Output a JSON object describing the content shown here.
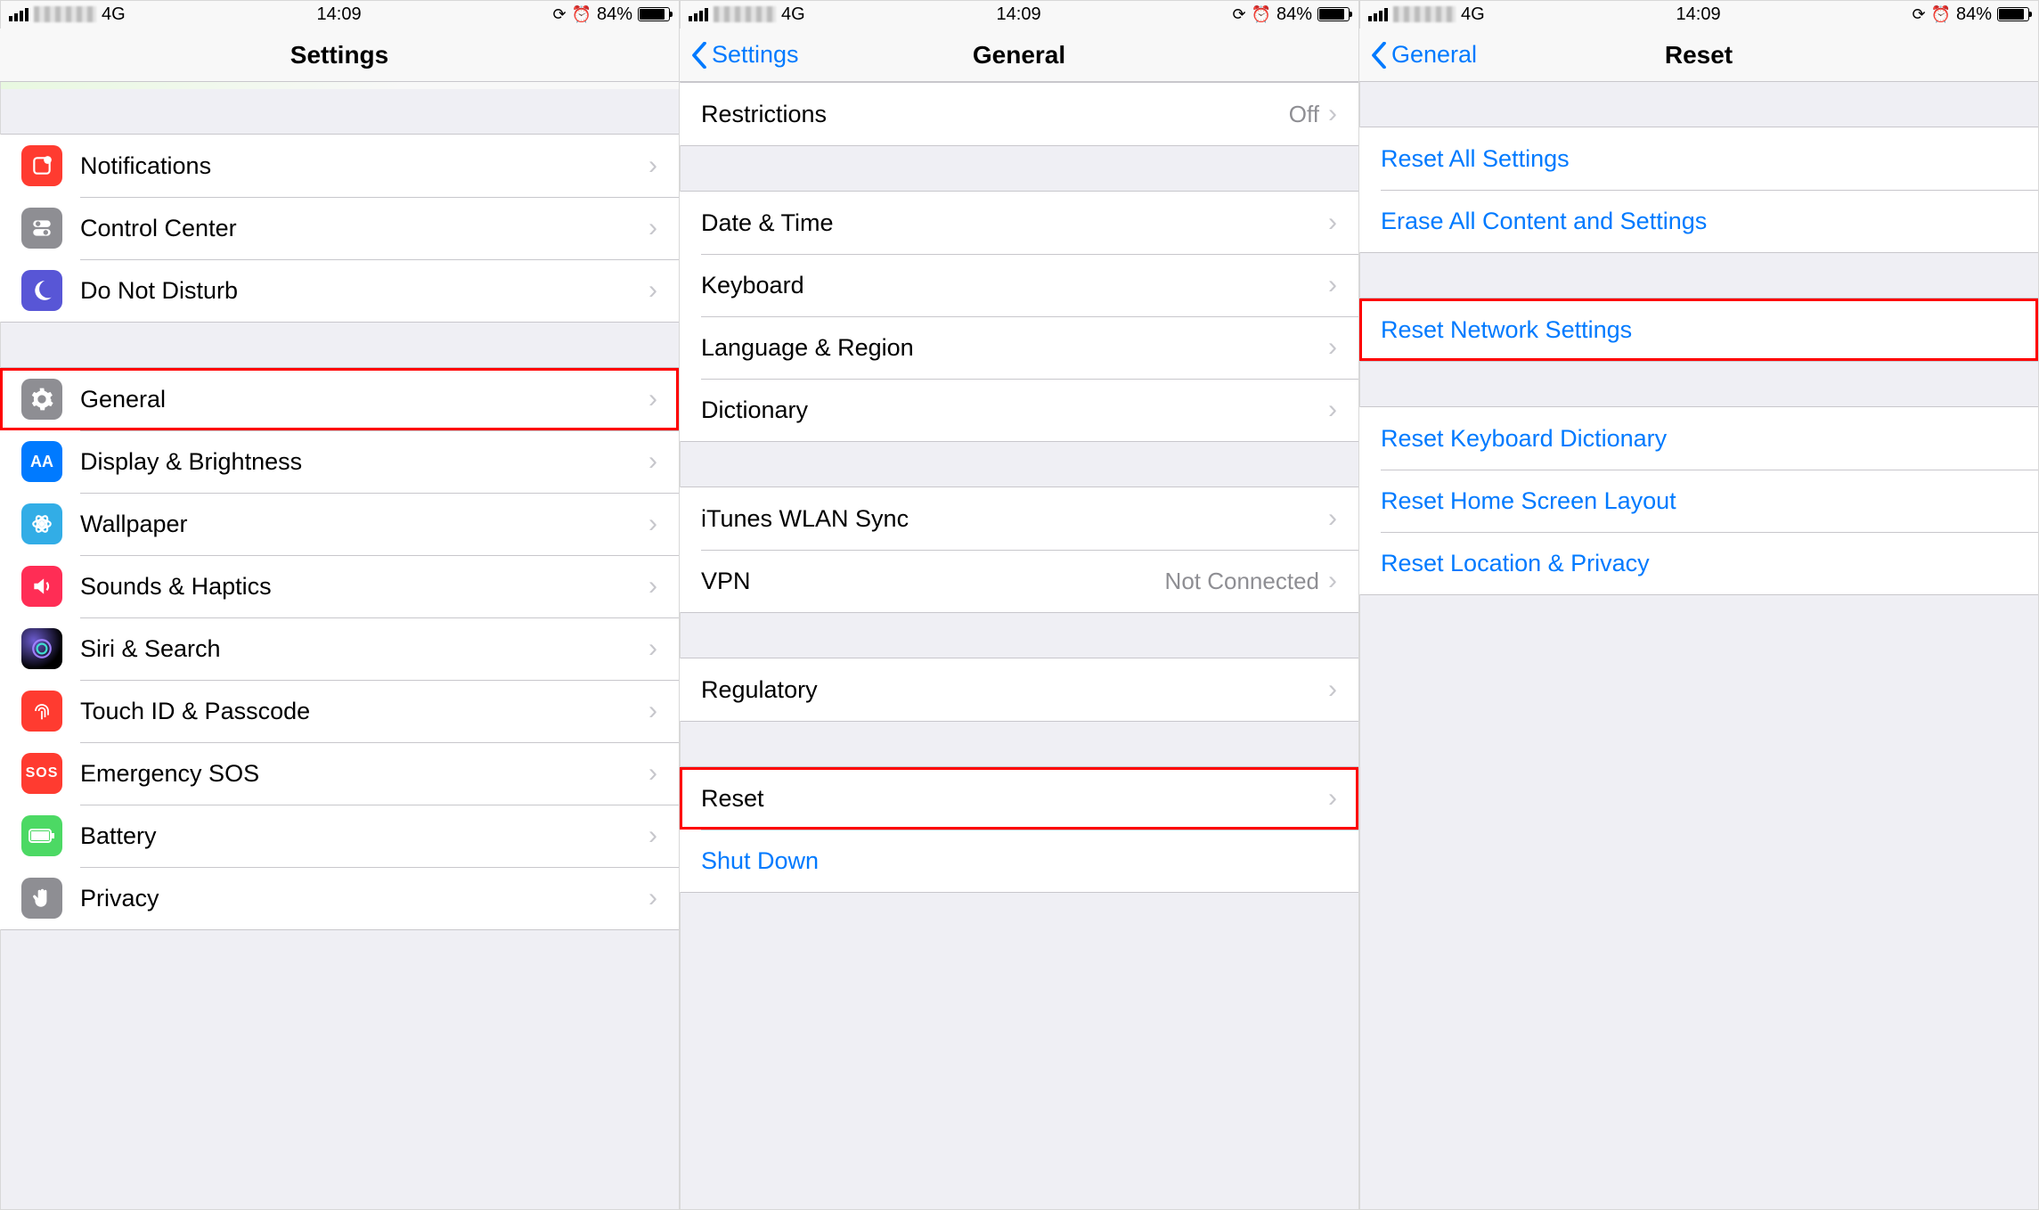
{
  "status": {
    "network": "4G",
    "time": "14:09",
    "battery_pct": "84%"
  },
  "panel1": {
    "title": "Settings",
    "groups": [
      {
        "rows": [
          {
            "icon": "notifications-icon",
            "color": "ic-red",
            "glyph": "☐",
            "label": "Notifications"
          },
          {
            "icon": "control-center-icon",
            "color": "ic-gray",
            "glyph": "⌾",
            "label": "Control Center"
          },
          {
            "icon": "dnd-icon",
            "color": "ic-purple",
            "glyph": "☾",
            "label": "Do Not Disturb"
          }
        ]
      },
      {
        "rows": [
          {
            "icon": "general-icon",
            "color": "ic-gray",
            "glyph": "⚙",
            "label": "General",
            "highlight": true
          },
          {
            "icon": "display-icon",
            "color": "ic-brightness",
            "glyph": "AA",
            "label": "Display & Brightness"
          },
          {
            "icon": "wallpaper-icon",
            "color": "ic-cyan",
            "glyph": "❀",
            "label": "Wallpaper"
          },
          {
            "icon": "sounds-icon",
            "color": "ic-pink",
            "glyph": "🔊",
            "label": "Sounds & Haptics"
          },
          {
            "icon": "siri-icon",
            "color": "ic-black",
            "glyph": "◉",
            "label": "Siri & Search"
          },
          {
            "icon": "touchid-icon",
            "color": "ic-red",
            "glyph": "◉",
            "label": "Touch ID & Passcode"
          },
          {
            "icon": "sos-icon",
            "color": "ic-sos",
            "glyph": "SOS",
            "label": "Emergency SOS"
          },
          {
            "icon": "battery-icon",
            "color": "ic-green",
            "glyph": "▮",
            "label": "Battery"
          },
          {
            "icon": "privacy-icon",
            "color": "ic-hand",
            "glyph": "✋",
            "label": "Privacy"
          }
        ]
      }
    ]
  },
  "panel2": {
    "back": "Settings",
    "title": "General",
    "groups": [
      {
        "rows": [
          {
            "label": "Restrictions",
            "value": "Off"
          }
        ]
      },
      {
        "rows": [
          {
            "label": "Date & Time"
          },
          {
            "label": "Keyboard"
          },
          {
            "label": "Language & Region"
          },
          {
            "label": "Dictionary"
          }
        ]
      },
      {
        "rows": [
          {
            "label": "iTunes WLAN Sync"
          },
          {
            "label": "VPN",
            "value": "Not Connected"
          }
        ]
      },
      {
        "rows": [
          {
            "label": "Regulatory"
          }
        ]
      },
      {
        "rows": [
          {
            "label": "Reset",
            "highlight": true
          },
          {
            "label": "Shut Down",
            "link": true,
            "no_chevron": true
          }
        ]
      }
    ]
  },
  "panel3": {
    "back": "General",
    "title": "Reset",
    "groups": [
      {
        "rows": [
          {
            "label": "Reset All Settings",
            "link": true
          },
          {
            "label": "Erase All Content and Settings",
            "link": true
          }
        ]
      },
      {
        "rows": [
          {
            "label": "Reset Network Settings",
            "link": true,
            "highlight": true
          }
        ]
      },
      {
        "rows": [
          {
            "label": "Reset Keyboard Dictionary",
            "link": true
          },
          {
            "label": "Reset Home Screen Layout",
            "link": true
          },
          {
            "label": "Reset Location & Privacy",
            "link": true
          }
        ]
      }
    ]
  }
}
